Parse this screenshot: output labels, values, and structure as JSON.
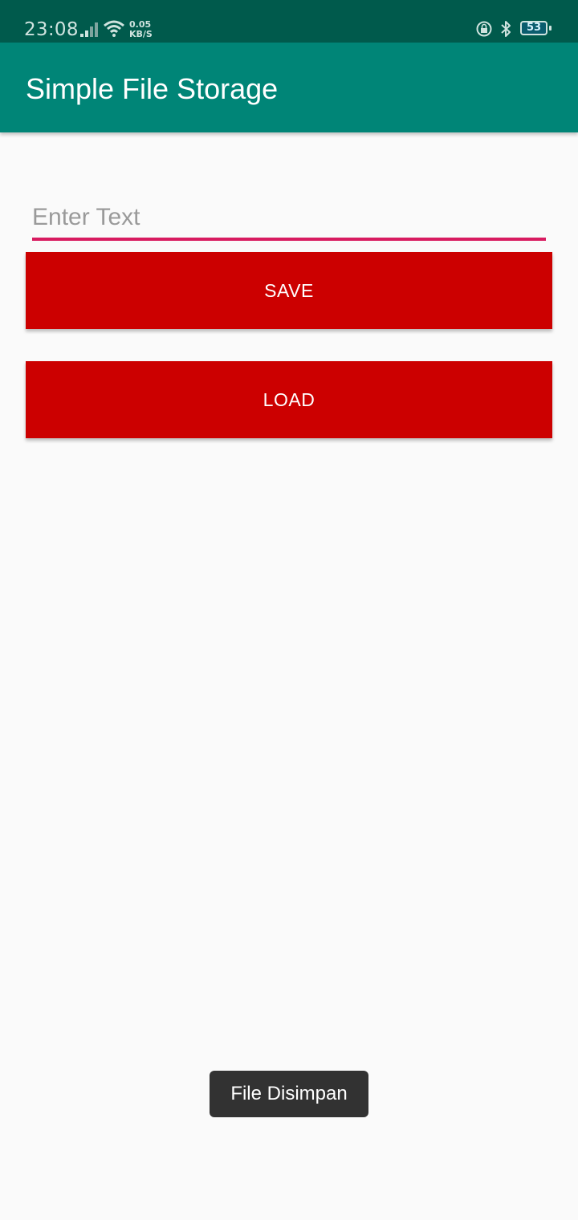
{
  "status_bar": {
    "time": "23:08",
    "net_speed_value": "0.05",
    "net_speed_unit": "KB/S",
    "battery_level": "53",
    "icons": [
      "signal-icon",
      "wifi-icon",
      "lock-icon",
      "bluetooth-icon",
      "battery-icon"
    ]
  },
  "app_bar": {
    "title": "Simple File Storage"
  },
  "form": {
    "input_placeholder": "Enter Text",
    "input_value": "",
    "save_label": "SAVE",
    "load_label": "LOAD"
  },
  "toast": {
    "message": "File Disimpan"
  },
  "colors": {
    "status_bar": "#005a4c",
    "app_bar": "#008577",
    "button": "#cc0000",
    "input_underline": "#d81b60",
    "toast": "#323232",
    "background": "#fafafa"
  }
}
